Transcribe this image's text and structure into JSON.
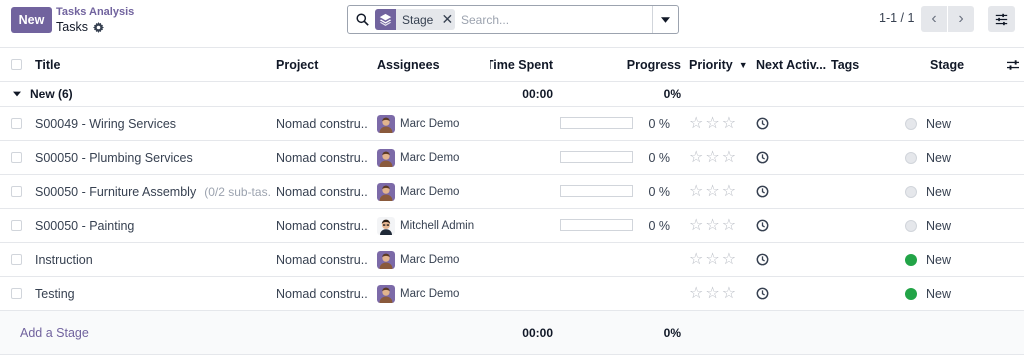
{
  "controlPanel": {
    "newButton": "New",
    "breadcrumb": "Tasks Analysis",
    "title": "Tasks",
    "facet": "Stage",
    "searchPlaceholder": "Search...",
    "pager": "1-1 / 1"
  },
  "columns": {
    "title": "Title",
    "project": "Project",
    "assignees": "Assignees",
    "timeSpent": "Time Spent",
    "progress": "Progress",
    "priority": "Priority",
    "nextActivity": "Next Activ...",
    "tags": "Tags",
    "stage": "Stage"
  },
  "group": {
    "label": "New (6)",
    "time": "00:00",
    "progress": "0%"
  },
  "rows": [
    {
      "title": "S00049 - Wiring Services",
      "sub": "",
      "project": "Nomad constru...",
      "assignee": "Marc Demo",
      "progress": "0 %",
      "stage": "New",
      "dot": "grey"
    },
    {
      "title": "S00050 - Plumbing Services",
      "sub": "",
      "project": "Nomad constru...",
      "assignee": "Marc Demo",
      "progress": "0 %",
      "stage": "New",
      "dot": "grey"
    },
    {
      "title": "S00050 - Furniture Assembly",
      "sub": "(0/2 sub-tas...",
      "project": "Nomad constru...",
      "assignee": "Marc Demo",
      "progress": "0 %",
      "stage": "New",
      "dot": "grey"
    },
    {
      "title": "S00050 - Painting",
      "sub": "",
      "project": "Nomad constru...",
      "assignee": "Mitchell Admin",
      "progress": "0 %",
      "stage": "New",
      "dot": "grey"
    },
    {
      "title": "Instruction",
      "sub": "",
      "project": "Nomad constru...",
      "assignee": "Marc Demo",
      "progress": "",
      "stage": "New",
      "dot": "green"
    },
    {
      "title": "Testing",
      "sub": "",
      "project": "Nomad constru...",
      "assignee": "Marc Demo",
      "progress": "",
      "stage": "New",
      "dot": "green"
    }
  ],
  "footer": {
    "addStage": "Add a Stage",
    "time": "00:00",
    "progress": "0%"
  },
  "colors": {
    "accent": "#71639e",
    "doneDot": "#22a447",
    "greyDot": "#e5e7eb"
  }
}
